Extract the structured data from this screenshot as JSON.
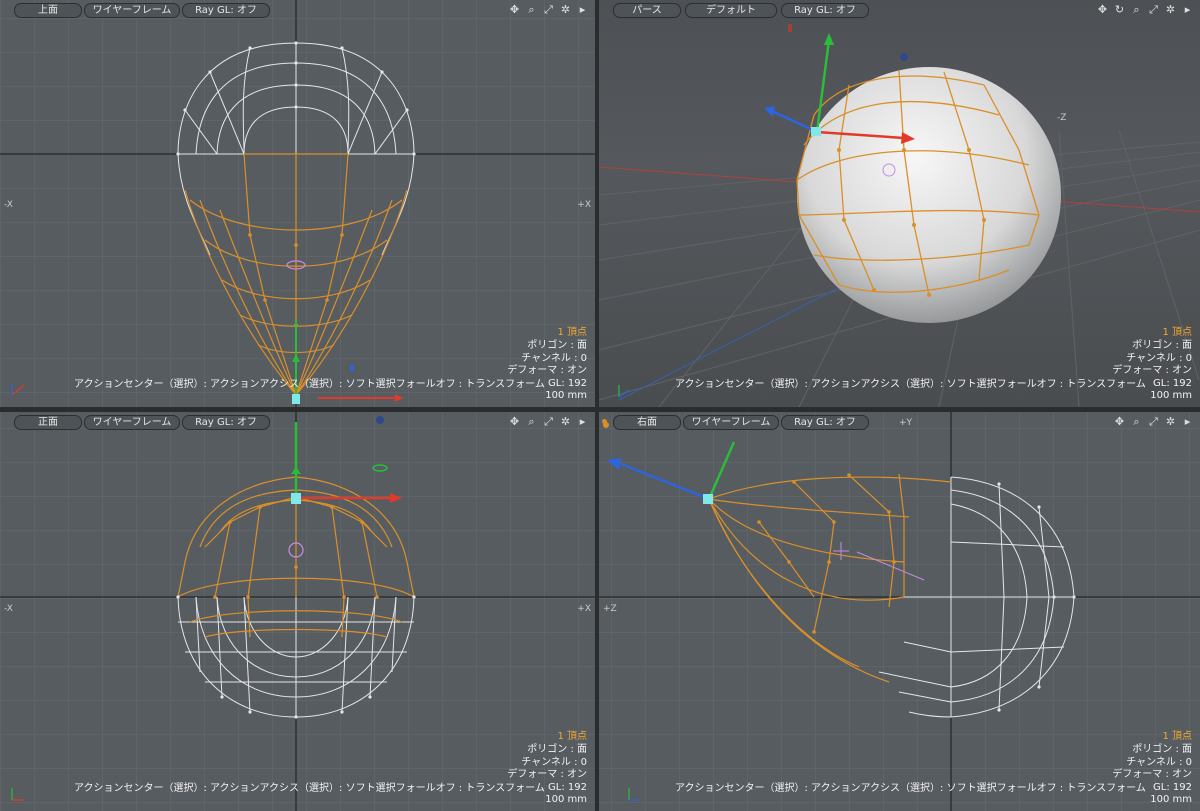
{
  "viewports": [
    {
      "id": "top",
      "view_label": "上面",
      "shading_label": "ワイヤーフレーム",
      "raygl_label": "Ray GL: オフ",
      "axis_left": "-X",
      "axis_right": "+X",
      "axis_top": "",
      "info": {
        "selection": "1 頂点",
        "polygon": "ポリゴン : 面",
        "channel": "チャンネル : 0",
        "deformer": "デフォーマ : オン",
        "gl": "GL: 192",
        "scale": "100 mm"
      },
      "status": "アクションセンター（選択）: アクションアクシス（選択）: ソフト選択フォールオフ : トランスフォーム"
    },
    {
      "id": "perspective",
      "view_label": "パース",
      "shading_label": "デフォルト",
      "raygl_label": "Ray GL: オフ",
      "axis_left": "",
      "axis_right": "-Z",
      "axis_top": "",
      "info": {
        "selection": "1 頂点",
        "polygon": "ポリゴン : 面",
        "channel": "チャンネル : 0",
        "deformer": "デフォーマ : オン",
        "gl": "GL: 192",
        "scale": "100 mm"
      },
      "status": "アクションセンター（選択）: アクションアクシス（選択）: ソフト選択フォールオフ : トランスフォーム"
    },
    {
      "id": "front",
      "view_label": "正面",
      "shading_label": "ワイヤーフレーム",
      "raygl_label": "Ray GL: オフ",
      "axis_left": "-X",
      "axis_right": "+X",
      "axis_top": "",
      "info": {
        "selection": "1 頂点",
        "polygon": "ポリゴン : 面",
        "channel": "チャンネル : 0",
        "deformer": "デフォーマ : オン",
        "gl": "GL: 192",
        "scale": "100 mm"
      },
      "status": "アクションセンター（選択）: アクションアクシス（選択）: ソフト選択フォールオフ : トランスフォーム"
    },
    {
      "id": "right",
      "view_label": "右面",
      "shading_label": "ワイヤーフレーム",
      "raygl_label": "Ray GL: オフ",
      "axis_left": "+Z",
      "axis_right": "",
      "axis_top": "+Y",
      "info": {
        "selection": "1 頂点",
        "polygon": "ポリゴン : 面",
        "channel": "チャンネル : 0",
        "deformer": "デフォーマ : オン",
        "gl": "GL: 192",
        "scale": "100 mm"
      },
      "status": "アクションセンター（選択）: アクションアクシス（選択）: ソフト選択フォールオフ : トランスフォーム"
    }
  ],
  "toolbar_icons": [
    "move-view-icon",
    "zoom-view-icon",
    "maximize-icon",
    "gear-icon",
    "expand-arrow-icon"
  ],
  "colors": {
    "background": "#575c61",
    "grid": "#6a7075",
    "wire": "#e6e6e6",
    "selection": "#d9902a",
    "x_axis": "#e23a2a",
    "y_axis": "#2bbd3a",
    "z_axis": "#2f64e0",
    "handle": "#7fe8e8"
  }
}
